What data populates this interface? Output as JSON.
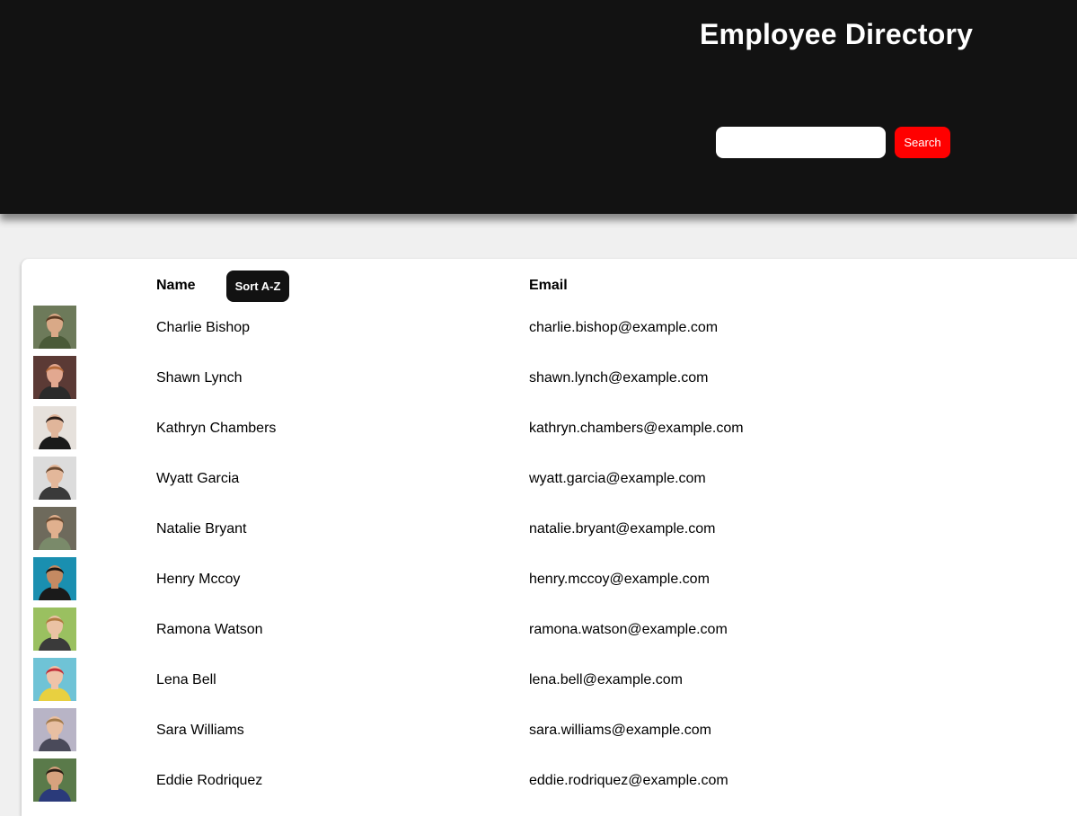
{
  "header": {
    "title": "Employee Directory",
    "search": {
      "value": "",
      "placeholder": ""
    },
    "search_label": "Search"
  },
  "table": {
    "headers": {
      "name": "Name",
      "email": "Email"
    },
    "sort_label": "Sort A-Z",
    "rows": [
      {
        "name": "Charlie Bishop",
        "email": "charlie.bishop@example.com",
        "avatar": {
          "bg": "#6d7a5a",
          "skin": "#d9a987",
          "hair": "#5a3a22",
          "shirt": "#4a5a38"
        }
      },
      {
        "name": "Shawn Lynch",
        "email": "shawn.lynch@example.com",
        "avatar": {
          "bg": "#5b3a35",
          "skin": "#e2a890",
          "hair": "#b56a3a",
          "shirt": "#2b2b2b"
        }
      },
      {
        "name": "Kathryn Chambers",
        "email": "kathryn.chambers@example.com",
        "avatar": {
          "bg": "#e6e1dc",
          "skin": "#e0b59a",
          "hair": "#2a1d18",
          "shirt": "#1a1a1a"
        }
      },
      {
        "name": "Wyatt Garcia",
        "email": "wyatt.garcia@example.com",
        "avatar": {
          "bg": "#dcdcdc",
          "skin": "#e3b79a",
          "hair": "#6a4a32",
          "shirt": "#3a3a3a"
        }
      },
      {
        "name": "Natalie Bryant",
        "email": "natalie.bryant@example.com",
        "avatar": {
          "bg": "#6e6a5c",
          "skin": "#e0b08e",
          "hair": "#6b4a30",
          "shirt": "#7a8a6a"
        }
      },
      {
        "name": "Henry Mccoy",
        "email": "henry.mccoy@example.com",
        "avatar": {
          "bg": "#1a8fb0",
          "skin": "#c48a62",
          "hair": "#1b1410",
          "shirt": "#1a1a1a"
        }
      },
      {
        "name": "Ramona Watson",
        "email": "ramona.watson@example.com",
        "avatar": {
          "bg": "#9ac060",
          "skin": "#eac2a4",
          "hair": "#b07a40",
          "shirt": "#3a3a3a"
        }
      },
      {
        "name": "Lena Bell",
        "email": "lena.bell@example.com",
        "avatar": {
          "bg": "#6fc3d6",
          "skin": "#efc3a8",
          "hair": "#c2303a",
          "shirt": "#e8d040"
        }
      },
      {
        "name": "Sara Williams",
        "email": "sara.williams@example.com",
        "avatar": {
          "bg": "#b8b4c6",
          "skin": "#e8bfa2",
          "hair": "#a37a4a",
          "shirt": "#4a4a5a"
        }
      },
      {
        "name": "Eddie Rodriquez",
        "email": "eddie.rodriquez@example.com",
        "avatar": {
          "bg": "#5a7a4a",
          "skin": "#d6a27e",
          "hair": "#2a1d14",
          "shirt": "#2a3a7a"
        }
      }
    ]
  },
  "colors": {
    "header_bg": "#121212",
    "accent": "#ff0000",
    "page_bg": "#f0f0f0",
    "sort_button_bg": "#121212"
  }
}
